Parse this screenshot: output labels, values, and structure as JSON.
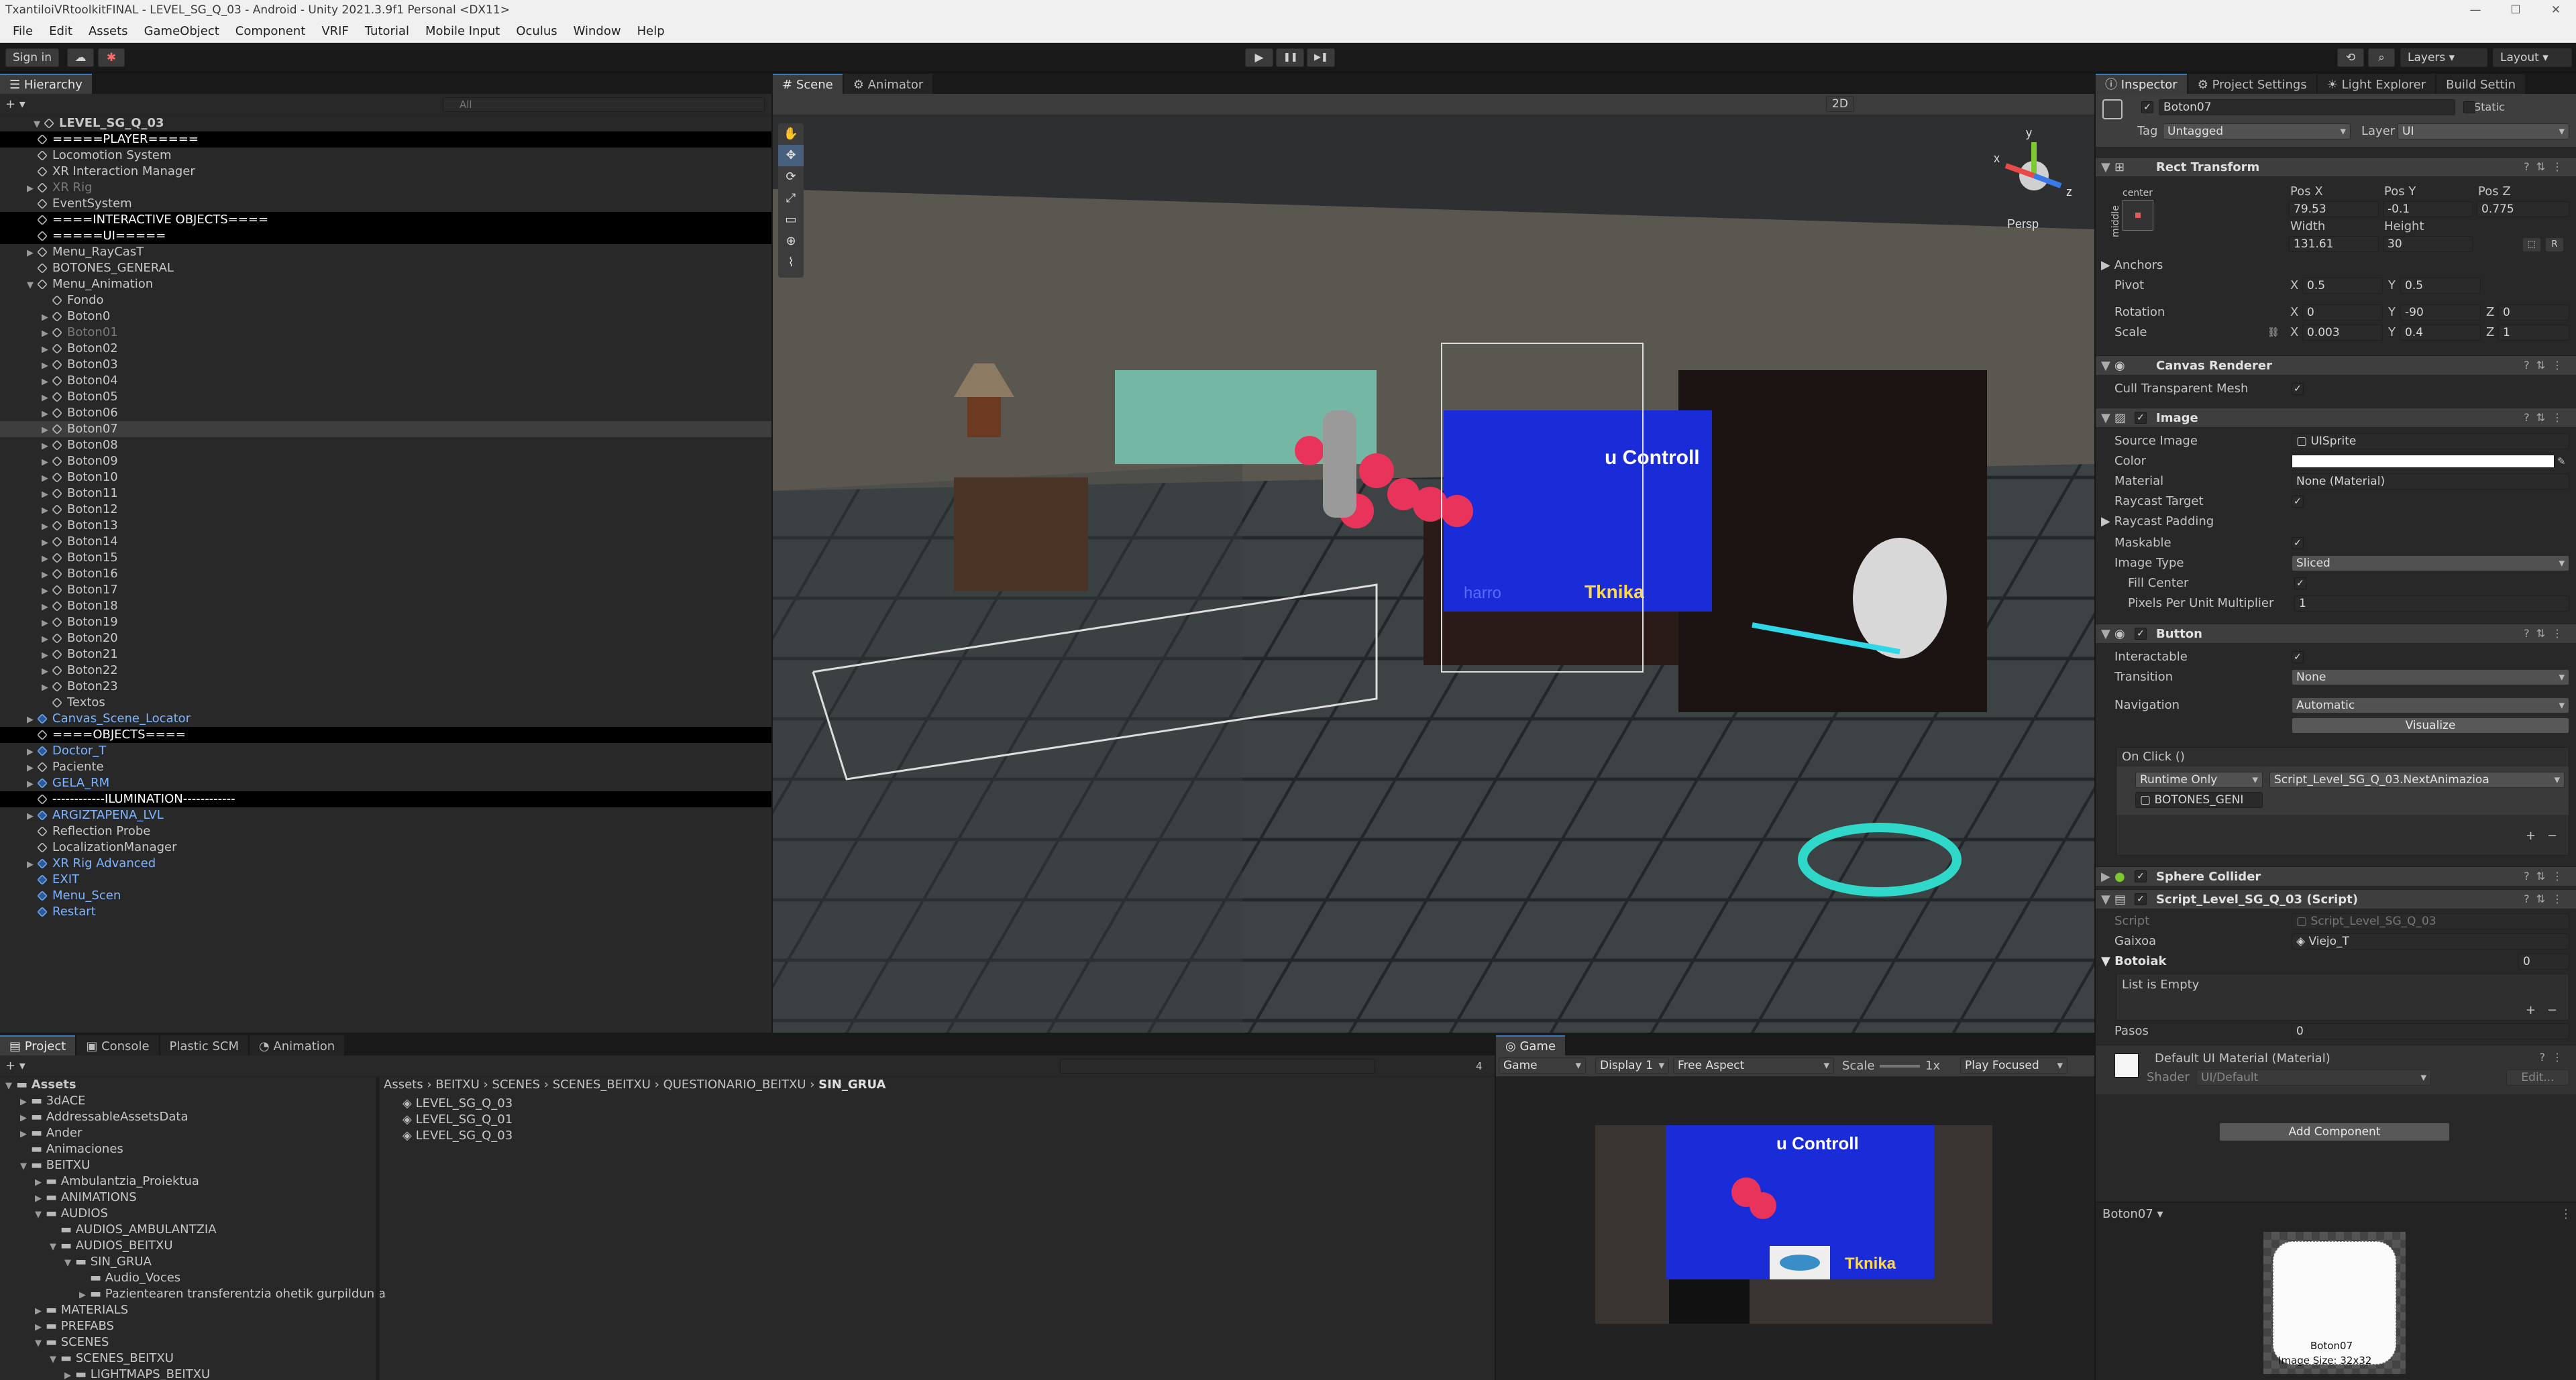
{
  "window": {
    "title": "TxantiloiVRtoolkitFINAL - LEVEL_SG_Q_03 - Android - Unity 2021.3.9f1 Personal <DX11>",
    "min": "—",
    "max": "☐",
    "close": "✕"
  },
  "menu": [
    "File",
    "Edit",
    "Assets",
    "GameObject",
    "Component",
    "VRIF",
    "Tutorial",
    "Mobile Input",
    "Oculus",
    "Window",
    "Help"
  ],
  "toolbar": {
    "sign_in": "Sign in",
    "cloud_icon": "☁",
    "collab_icon": "✱",
    "play": "▶",
    "pause": "❚❚",
    "step": "▶❚",
    "layers": "Layers",
    "layout": "Layout",
    "history_icon": "⟲",
    "search_icon": "⌕"
  },
  "hierarchy": {
    "tab": "Hierarchy",
    "search_placeholder": "All",
    "add": "+ ▾",
    "rows": [
      {
        "t": "LEVEL_SG_Q_03",
        "i": 0,
        "k": "scene",
        "a": "▼"
      },
      {
        "t": "=====PLAYER=====",
        "i": 1,
        "k": "sep"
      },
      {
        "t": "Locomotion System",
        "i": 1
      },
      {
        "t": "XR Interaction Manager",
        "i": 1
      },
      {
        "t": "XR Rig",
        "i": 1,
        "k": "dim",
        "a": "▶"
      },
      {
        "t": "EventSystem",
        "i": 1
      },
      {
        "t": "====INTERACTIVE OBJECTS====",
        "i": 1,
        "k": "sep"
      },
      {
        "t": "=====UI=====",
        "i": 1,
        "k": "sep"
      },
      {
        "t": "Menu_RayCasT",
        "i": 1,
        "a": "▶"
      },
      {
        "t": "BOTONES_GENERAL",
        "i": 1
      },
      {
        "t": "Menu_Animation",
        "i": 1,
        "a": "▼"
      },
      {
        "t": "Fondo",
        "i": 2
      },
      {
        "t": "Boton0",
        "i": 2,
        "a": "▶"
      },
      {
        "t": "Boton01",
        "i": 2,
        "k": "dim",
        "a": "▶"
      },
      {
        "t": "Boton02",
        "i": 2,
        "a": "▶"
      },
      {
        "t": "Boton03",
        "i": 2,
        "a": "▶"
      },
      {
        "t": "Boton04",
        "i": 2,
        "a": "▶"
      },
      {
        "t": "Boton05",
        "i": 2,
        "a": "▶"
      },
      {
        "t": "Boton06",
        "i": 2,
        "a": "▶"
      },
      {
        "t": "Boton07",
        "i": 2,
        "k": "sel",
        "a": "▶"
      },
      {
        "t": "Boton08",
        "i": 2,
        "a": "▶"
      },
      {
        "t": "Boton09",
        "i": 2,
        "a": "▶"
      },
      {
        "t": "Boton10",
        "i": 2,
        "a": "▶"
      },
      {
        "t": "Boton11",
        "i": 2,
        "a": "▶"
      },
      {
        "t": "Boton12",
        "i": 2,
        "a": "▶"
      },
      {
        "t": "Boton13",
        "i": 2,
        "a": "▶"
      },
      {
        "t": "Boton14",
        "i": 2,
        "a": "▶"
      },
      {
        "t": "Boton15",
        "i": 2,
        "a": "▶"
      },
      {
        "t": "Boton16",
        "i": 2,
        "a": "▶"
      },
      {
        "t": "Boton17",
        "i": 2,
        "a": "▶"
      },
      {
        "t": "Boton18",
        "i": 2,
        "a": "▶"
      },
      {
        "t": "Boton19",
        "i": 2,
        "a": "▶"
      },
      {
        "t": "Boton20",
        "i": 2,
        "a": "▶"
      },
      {
        "t": "Boton21",
        "i": 2,
        "a": "▶"
      },
      {
        "t": "Boton22",
        "i": 2,
        "a": "▶"
      },
      {
        "t": "Boton23",
        "i": 2,
        "a": "▶"
      },
      {
        "t": "Textos",
        "i": 2
      },
      {
        "t": "Canvas_Scene_Locator",
        "i": 1,
        "k": "blue",
        "a": "▶"
      },
      {
        "t": "====OBJECTS====",
        "i": 1,
        "k": "sep"
      },
      {
        "t": "Doctor_T",
        "i": 1,
        "k": "blue",
        "a": "▶"
      },
      {
        "t": "Paciente",
        "i": 1,
        "a": "▶"
      },
      {
        "t": "GELA_RM",
        "i": 1,
        "k": "blue",
        "a": "▶"
      },
      {
        "t": "------------ILUMINATION------------",
        "i": 1,
        "k": "sep"
      },
      {
        "t": "ARGIZTAPENA_LVL",
        "i": 1,
        "k": "blue",
        "a": "▶"
      },
      {
        "t": "Reflection Probe",
        "i": 1
      },
      {
        "t": "LocalizationManager",
        "i": 1
      },
      {
        "t": "XR Rig Advanced",
        "i": 1,
        "k": "blue",
        "a": "▶"
      },
      {
        "t": "EXIT",
        "i": 1,
        "k": "blue"
      },
      {
        "t": "Menu_Scen",
        "i": 1,
        "k": "blue"
      },
      {
        "t": "Restart",
        "i": 1,
        "k": "blue"
      }
    ]
  },
  "scene": {
    "tabs": [
      "Scene",
      "Animator"
    ],
    "mode_2d": "2D",
    "persp": "Persp",
    "axis": {
      "x": "x",
      "y": "y",
      "z": "z"
    }
  },
  "panel_overlay": {
    "title": "u Controll",
    "logo": "Tknika",
    "sub": "harro"
  },
  "project": {
    "tabs": [
      "Project",
      "Console",
      "Plastic SCM",
      "Animation"
    ],
    "count": "4",
    "tree": [
      {
        "t": "Assets",
        "i": 0,
        "a": "▼",
        "b": true
      },
      {
        "t": "3dACE",
        "i": 1,
        "a": "▶"
      },
      {
        "t": "AddressableAssetsData",
        "i": 1,
        "a": "▶"
      },
      {
        "t": "Ander",
        "i": 1,
        "a": "▶"
      },
      {
        "t": "Animaciones",
        "i": 1
      },
      {
        "t": "BEITXU",
        "i": 1,
        "a": "▼"
      },
      {
        "t": "Ambulantzia_Proiektua",
        "i": 2,
        "a": "▶"
      },
      {
        "t": "ANIMATIONS",
        "i": 2,
        "a": "▶"
      },
      {
        "t": "AUDIOS",
        "i": 2,
        "a": "▼"
      },
      {
        "t": "AUDIOS_AMBULANTZIA",
        "i": 3
      },
      {
        "t": "AUDIOS_BEITXU",
        "i": 3,
        "a": "▼"
      },
      {
        "t": "SIN_GRUA",
        "i": 4,
        "a": "▼"
      },
      {
        "t": "Audio_Voces",
        "i": 5
      },
      {
        "t": "Pazientearen transferentzia ohetik gurpildun a",
        "i": 5,
        "a": "▶"
      },
      {
        "t": "MATERIALS",
        "i": 2,
        "a": "▶"
      },
      {
        "t": "PREFABS",
        "i": 2,
        "a": "▶"
      },
      {
        "t": "SCENES",
        "i": 2,
        "a": "▼"
      },
      {
        "t": "SCENES_BEITXU",
        "i": 3,
        "a": "▼"
      },
      {
        "t": "LIGHTMAPS_BEITXU",
        "i": 4,
        "a": "▶"
      }
    ],
    "breadcrumb": [
      "Assets",
      "BEITXU",
      "SCENES",
      "SCENES_BEITXU",
      "QUESTIONARIO_BEITXU",
      "SIN_GRUA"
    ],
    "files": [
      "LEVEL_SG_Q_03",
      "LEVEL_SG_Q_01",
      "LEVEL_SG_Q_03"
    ]
  },
  "game": {
    "tab": "Game",
    "mode": "Game",
    "display": "Display 1",
    "aspect": "Free Aspect",
    "scale_label": "Scale",
    "scale_value": "1x",
    "play_focused": "Play Focused"
  },
  "inspector": {
    "tabs": [
      "Inspector",
      "Project Settings",
      "Light Explorer",
      "Build Settin"
    ],
    "name": "Boton07",
    "static": "Static",
    "tag_label": "Tag",
    "tag": "Untagged",
    "layer_label": "Layer",
    "layer": "UI",
    "rect": {
      "title": "Rect Transform",
      "anchor_h": "center",
      "anchor_v": "middle",
      "posx_l": "Pos X",
      "posy_l": "Pos Y",
      "posz_l": "Pos Z",
      "posx": "79.53",
      "posy": "-0.1",
      "posz": "0.775",
      "w_l": "Width",
      "h_l": "Height",
      "w": "131.61",
      "h": "30",
      "anchors": "Anchors",
      "pivot": "Pivot",
      "pivot_x": "0.5",
      "pivot_y": "0.5",
      "rotation": "Rotation",
      "rot_x": "0",
      "rot_y": "-90",
      "rot_z": "0",
      "scale": "Scale",
      "sc_x": "0.003",
      "sc_y": "0.4",
      "sc_z": "1",
      "x": "X",
      "y": "Y",
      "z": "Z",
      "r": "R"
    },
    "canvas_renderer": {
      "title": "Canvas Renderer",
      "cull": "Cull Transparent Mesh"
    },
    "image": {
      "title": "Image",
      "source_l": "Source Image",
      "source": "UISprite",
      "color_l": "Color",
      "material_l": "Material",
      "material": "None (Material)",
      "raycast": "Raycast Target",
      "padding": "Raycast Padding",
      "maskable": "Maskable",
      "type_l": "Image Type",
      "type": "Sliced",
      "fill": "Fill Center",
      "ppu_l": "Pixels Per Unit Multiplier",
      "ppu": "1"
    },
    "button": {
      "title": "Button",
      "interactable": "Interactable",
      "transition_l": "Transition",
      "transition": "None",
      "nav_l": "Navigation",
      "nav": "Automatic",
      "visualize": "Visualize",
      "onclick": "On Click ()",
      "runtime": "Runtime Only",
      "func": "Script_Level_SG_Q_03.NextAnimazioa",
      "obj": "BOTONES_GENI"
    },
    "sphere": {
      "title": "Sphere Collider"
    },
    "script": {
      "title": "Script_Level_SG_Q_03 (Script)",
      "script_l": "Script",
      "script": "Script_Level_SG_Q_03",
      "gaixoa_l": "Gaixoa",
      "gaixoa": "Viejo_T",
      "botoiak": "Botoiak",
      "botoiak_n": "0",
      "empty": "List is Empty",
      "pasos_l": "Pasos",
      "pasos": "0"
    },
    "material": {
      "name": "Default UI Material (Material)",
      "shader_l": "Shader",
      "shader": "UI/Default",
      "edit": "Edit..."
    },
    "add": "Add Component",
    "preview": {
      "title": "Boton07 ▾",
      "name": "Boton07",
      "size": "Image Size: 32x32"
    },
    "plus": "+",
    "minus": "−",
    "help": "?",
    "menu": "⋮"
  }
}
